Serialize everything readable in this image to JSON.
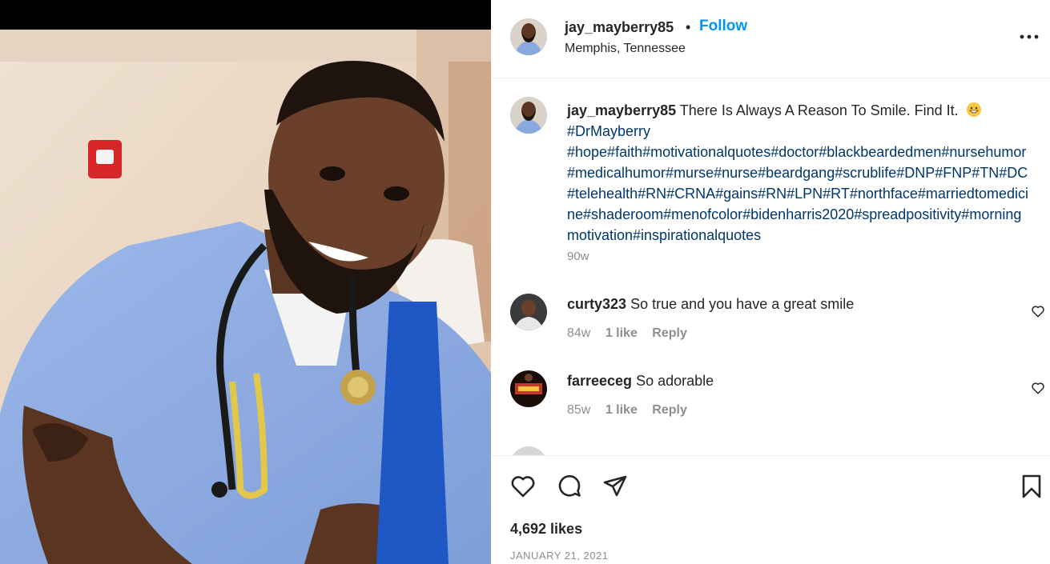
{
  "post": {
    "username": "jay_mayberry85",
    "separator": "•",
    "follow_label": "Follow",
    "location": "Memphis, Tennessee",
    "more_icon": "more-horizontal-icon"
  },
  "caption": {
    "username": "jay_mayberry85",
    "text": "There Is Always A Reason To Smile. Find It.",
    "emoji": "grinning-face-emoji",
    "tag_first": "#DrMayberry",
    "hashtags": "#hope#faith#motivationalquotes#doctor#blackbeardedmen#nursehumor#medicalhumor#murse#nurse#beardgang#scrublife#DNP#FNP#TN#DC#telehealth#RN#CRNA#gains#RN#LPN#RT#northface#marriedtomedicine#shaderoom#menofcolor#bidenharris2020#spreadpositivity#morningmotivation#inspirationalquotes",
    "time": "90w"
  },
  "comments": [
    {
      "username": "curty323",
      "text": "So true and you have a great smile",
      "time": "84w",
      "likes": "1 like",
      "reply": "Reply"
    },
    {
      "username": "farreeceg",
      "text": "So adorable",
      "time": "85w",
      "likes": "1 like",
      "reply": "Reply"
    }
  ],
  "actions": {
    "like_icon": "heart-icon",
    "comment_icon": "comment-bubble-icon",
    "share_icon": "paper-plane-icon",
    "save_icon": "bookmark-icon"
  },
  "likes_count": "4,692 likes",
  "date": "JANUARY 21, 2021",
  "colors": {
    "accent": "#0095f6",
    "hashtag": "#00376b",
    "muted": "#8e8e8e",
    "text": "#262626",
    "divider": "#efefef"
  }
}
